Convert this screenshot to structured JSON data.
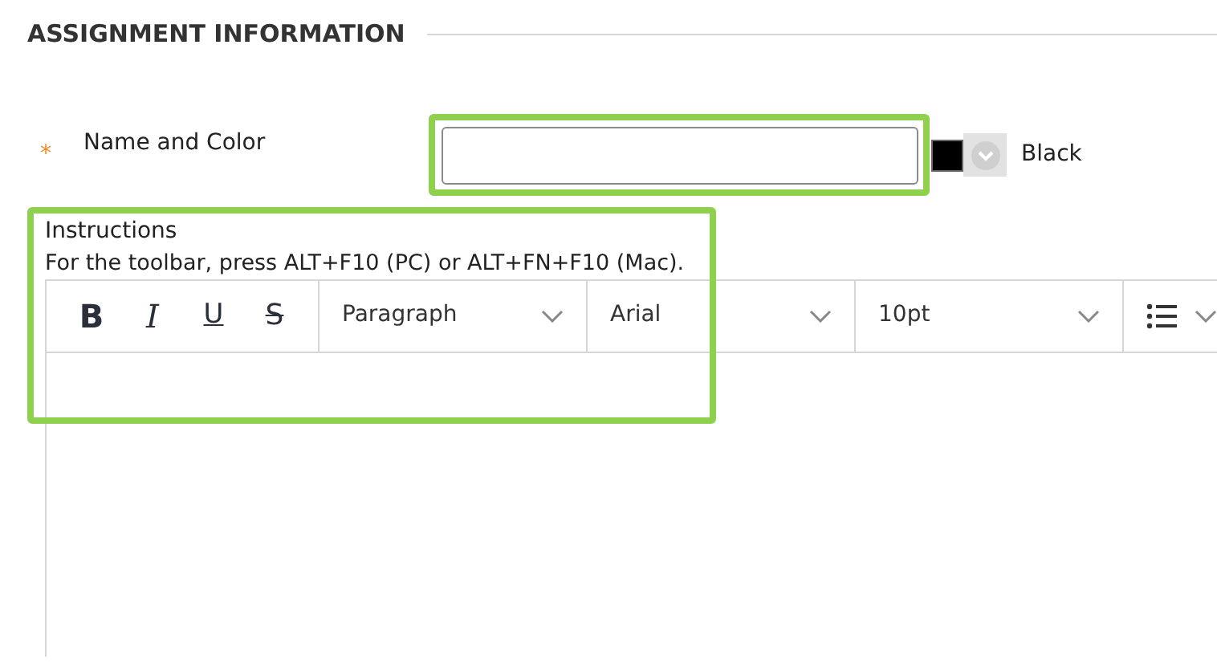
{
  "section": {
    "title": "ASSIGNMENT INFORMATION"
  },
  "name_field": {
    "label": "Name and Color",
    "required_mark": "*",
    "color": "#000000",
    "color_name": "Black"
  },
  "instructions": {
    "label": "Instructions",
    "hint": "For the toolbar, press ALT+F10 (PC) or ALT+FN+F10 (Mac)."
  },
  "toolbar": {
    "format_buttons": [
      {
        "kind": "bold",
        "label": "B"
      },
      {
        "kind": "italic",
        "label": "I"
      },
      {
        "kind": "underline",
        "label": "U"
      },
      {
        "kind": "strike",
        "label": "S"
      }
    ],
    "dropdowns": [
      {
        "value": "Paragraph"
      },
      {
        "value": "Arial"
      },
      {
        "value": "10pt"
      }
    ]
  }
}
